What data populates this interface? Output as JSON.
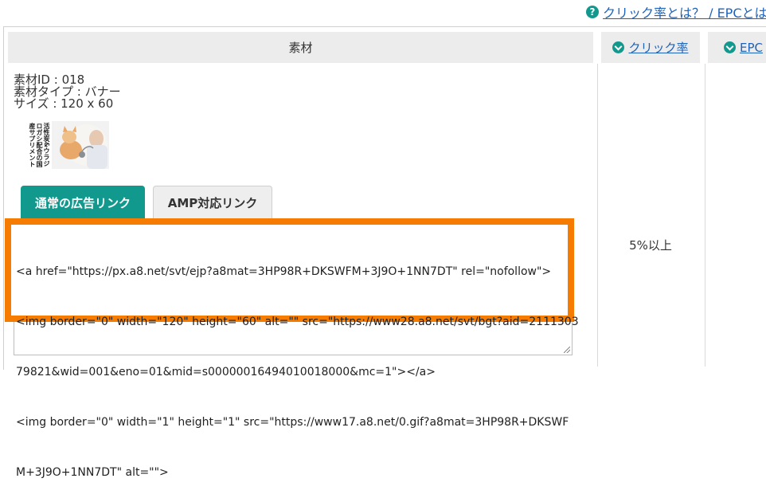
{
  "help": {
    "icon": "question-circle-icon",
    "link_text": "クリック率とは？ / EPCとは"
  },
  "table": {
    "col_material": "素材",
    "col_click_rate": "クリック率",
    "col_epc": "EPC"
  },
  "material": {
    "id_line": "素材ID : 018",
    "type_line": "素材タイプ : バナー",
    "size_line": "サイズ : 120 x 60",
    "banner_text": "活性炭&ウラジロガシ配合の国産サプリメント"
  },
  "tabs": {
    "normal": "通常の広告リンク",
    "amp": "AMP対応リンク"
  },
  "code_lines": [
    "<a href=\"https://px.a8.net/svt/ejp?a8mat=3HP98R+DKSWFM+3J9O+1NN7DT\" rel=\"nofollow\">",
    "<img border=\"0\" width=\"120\" height=\"60\" alt=\"\" src=\"https://www28.a8.net/svt/bgt?aid=2111303",
    "79821&wid=001&eno=01&mid=s00000016494010018000&mc=1\"></a>",
    "<img border=\"0\" width=\"1\" height=\"1\" src=\"https://www17.a8.net/0.gif?a8mat=3HP98R+DKSWF",
    "M+3J9O+1NN7DT\" alt=\"\">"
  ],
  "click_rate_value": "5%以上",
  "colors": {
    "accent": "#11998e",
    "highlight": "#f57c00",
    "link": "#1f63b8"
  }
}
